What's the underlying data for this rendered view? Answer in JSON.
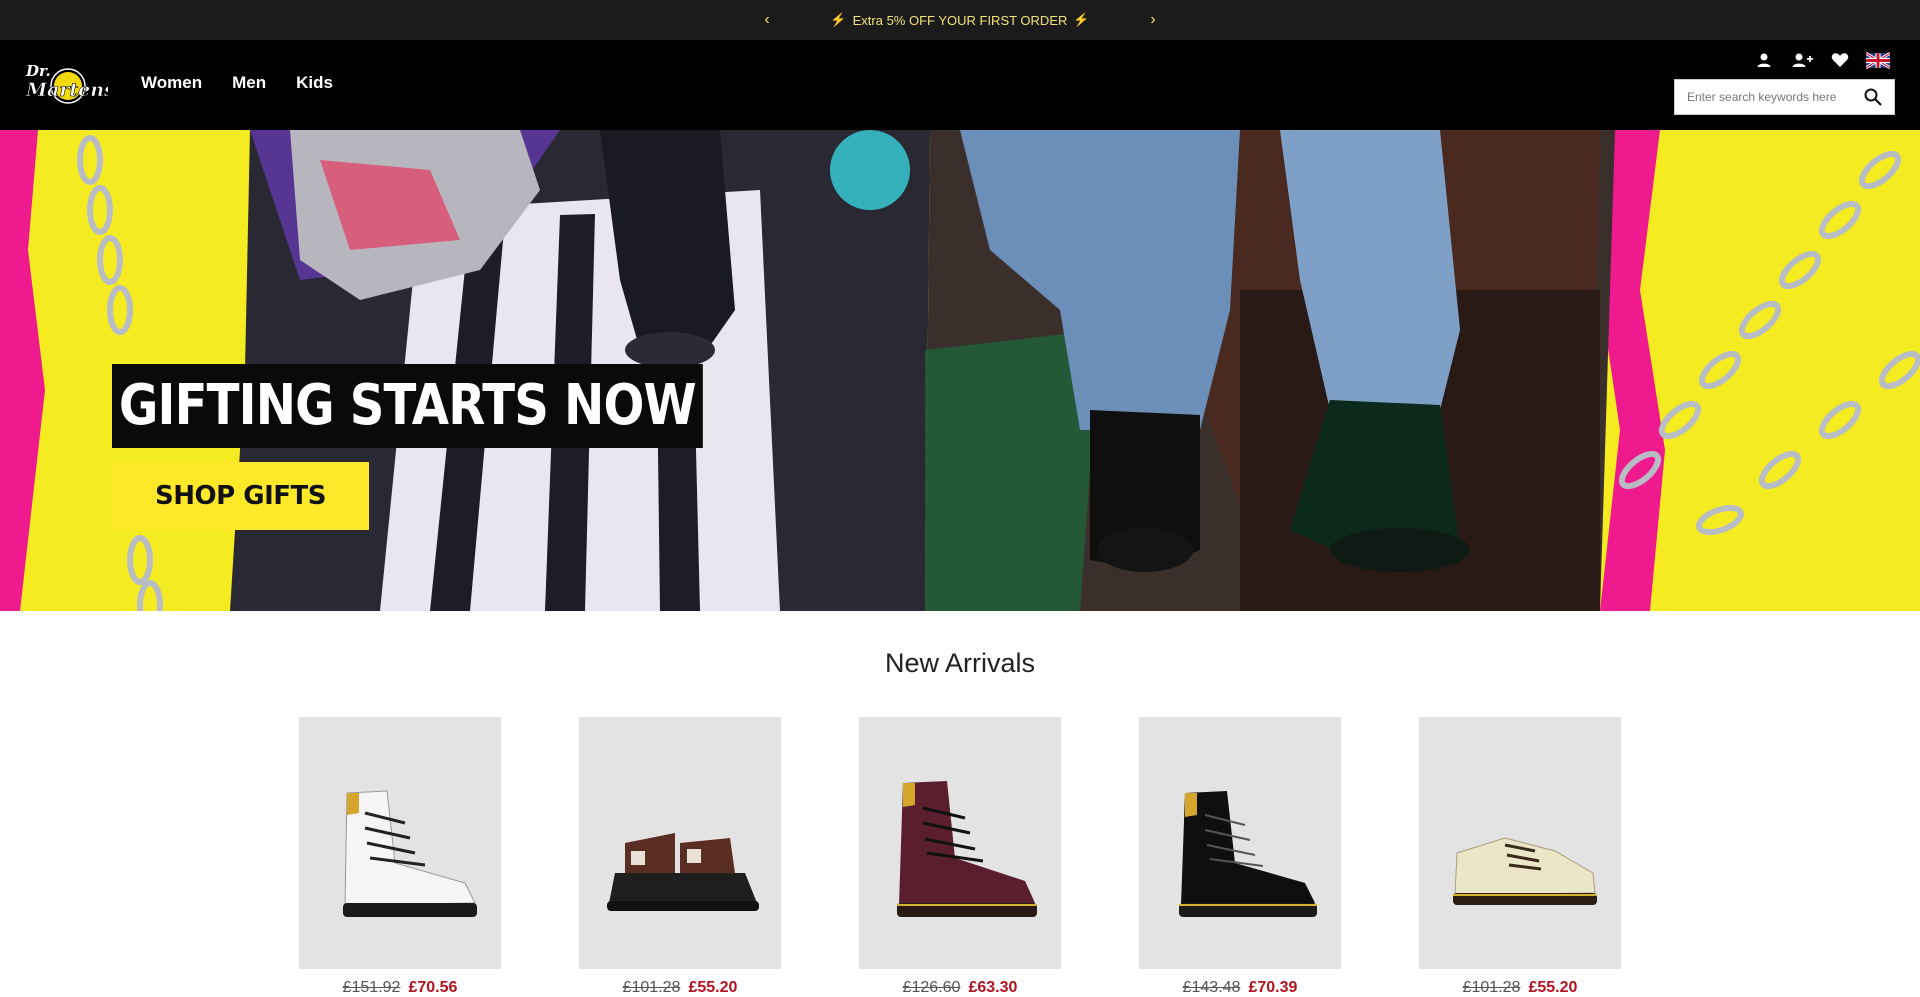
{
  "announcement": {
    "prev_icon": "chevron-left-icon",
    "next_icon": "chevron-right-icon",
    "message": "Extra 5% OFF YOUR FIRST ORDER",
    "bolt_glyph": "⚡"
  },
  "header": {
    "logo_text": "Dr. Martens",
    "nav": [
      {
        "label": "Women"
      },
      {
        "label": "Men"
      },
      {
        "label": "Kids"
      }
    ],
    "icons": [
      "account-icon",
      "register-icon",
      "wishlist-heart-icon",
      "uk-flag-icon"
    ],
    "search": {
      "placeholder": "Enter search keywords here"
    }
  },
  "hero": {
    "title": "GIFTING STARTS NOW",
    "cta": "SHOP GIFTS",
    "colors": {
      "yellow": "#f4ec20",
      "pink": "#f01a8f",
      "cta": "#fde92a"
    }
  },
  "new_arrivals": {
    "title": "New Arrivals",
    "products": [
      {
        "image": "white-8-eye-boot",
        "was": "£151.92",
        "now": "£70.56"
      },
      {
        "image": "brown-buckle-sandal",
        "was": "£101.28",
        "now": "£55.20"
      },
      {
        "image": "cherry-red-8-eye-boot",
        "was": "£126.60",
        "now": "£63.30"
      },
      {
        "image": "black-8-eye-boot",
        "was": "£143.48",
        "now": "£70.39"
      },
      {
        "image": "cream-3-eye-shoe",
        "was": "£101.28",
        "now": "£55.20"
      }
    ]
  }
}
